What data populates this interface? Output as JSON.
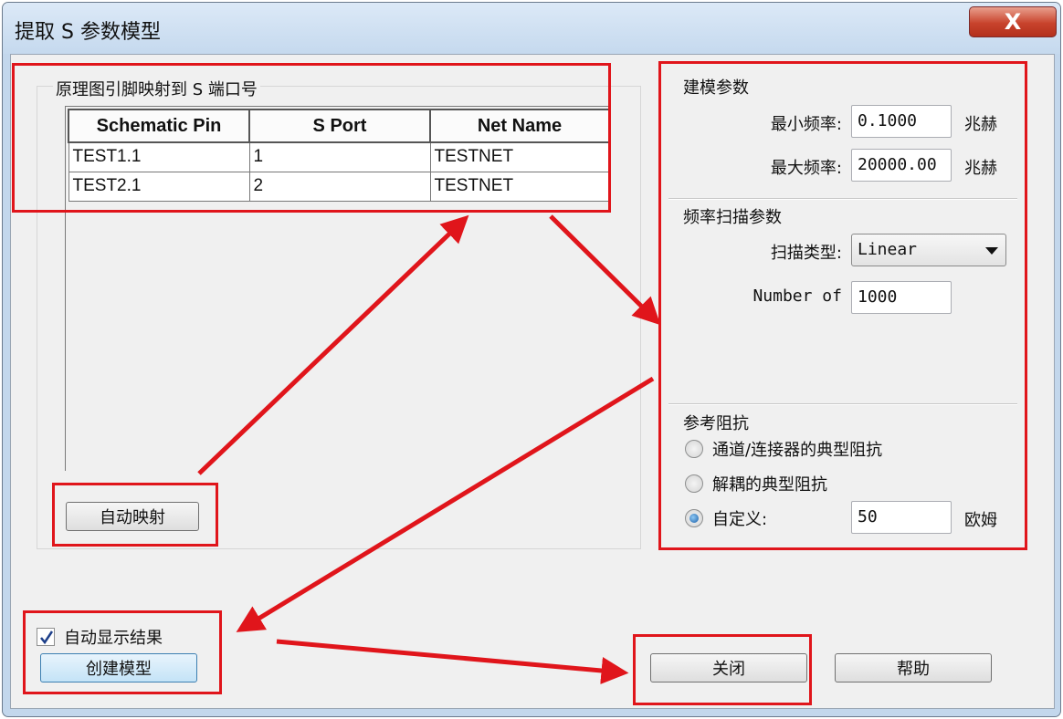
{
  "window": {
    "title": "提取 S 参数模型",
    "close_glyph": "X"
  },
  "mapping": {
    "group_label": "原理图引脚映射到 S 端口号",
    "columns": [
      "Schematic Pin",
      "S Port",
      "Net Name"
    ],
    "rows": [
      [
        "TEST1.1",
        "1",
        "TESTNET"
      ],
      [
        "TEST2.1",
        "2",
        "TESTNET"
      ]
    ],
    "auto_map_button": "自动映射"
  },
  "modeling": {
    "title": "建模参数",
    "min_freq_label": "最小频率:",
    "min_freq_value": "0.1000",
    "max_freq_label": "最大频率:",
    "max_freq_value": "20000.00",
    "unit": "兆赫"
  },
  "sweep": {
    "title": "频率扫描参数",
    "type_label": "扫描类型:",
    "type_value": "Linear",
    "number_label": "Number of",
    "number_value": "1000"
  },
  "impedance": {
    "title": "参考阻抗",
    "options": [
      "通道/连接器的典型阻抗",
      "解耦的典型阻抗",
      "自定义:"
    ],
    "selected_index": 2,
    "custom_value": "50",
    "custom_unit": "欧姆"
  },
  "footer": {
    "auto_show_label": "自动显示结果",
    "auto_show_checked": true,
    "create_button": "创建模型",
    "close_button": "关闭",
    "help_button": "帮助"
  },
  "annotation_color": "#e0151b"
}
